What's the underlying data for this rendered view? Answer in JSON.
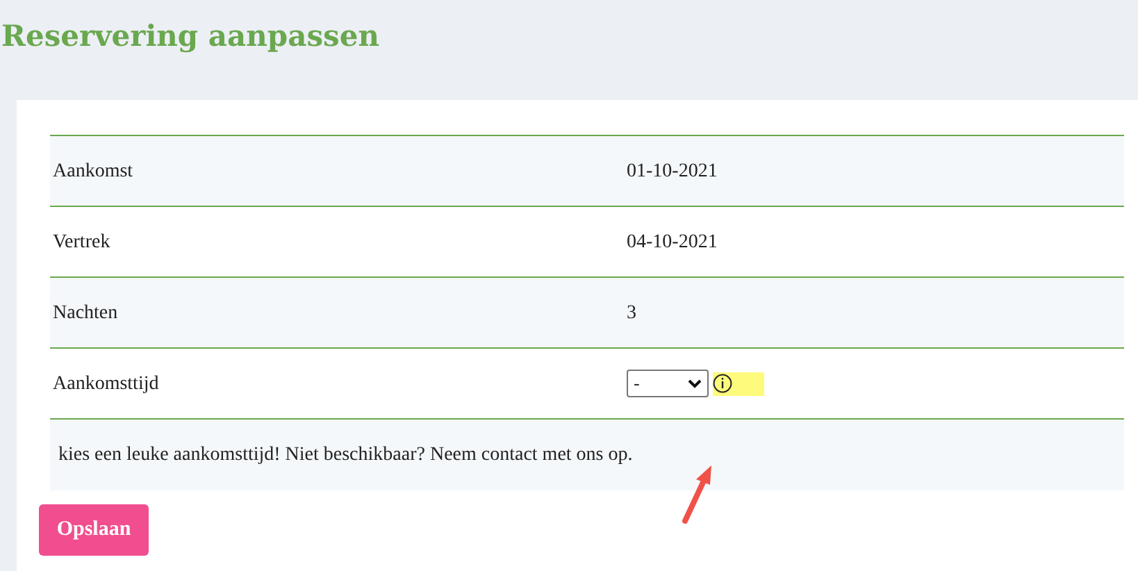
{
  "page": {
    "title": "Reservering aanpassen"
  },
  "rows": [
    {
      "kind": "text",
      "label": "Aankomst",
      "value": "01-10-2021"
    },
    {
      "kind": "text",
      "label": "Vertrek",
      "value": "04-10-2021"
    },
    {
      "kind": "text",
      "label": "Nachten",
      "value": "3"
    },
    {
      "kind": "select",
      "label": "Aankomsttijd",
      "value": "-"
    }
  ],
  "note": "kies een leuke aankomsttijd! Niet beschikbaar? Neem contact met ons op.",
  "buttons": [
    "Opslaan"
  ]
}
